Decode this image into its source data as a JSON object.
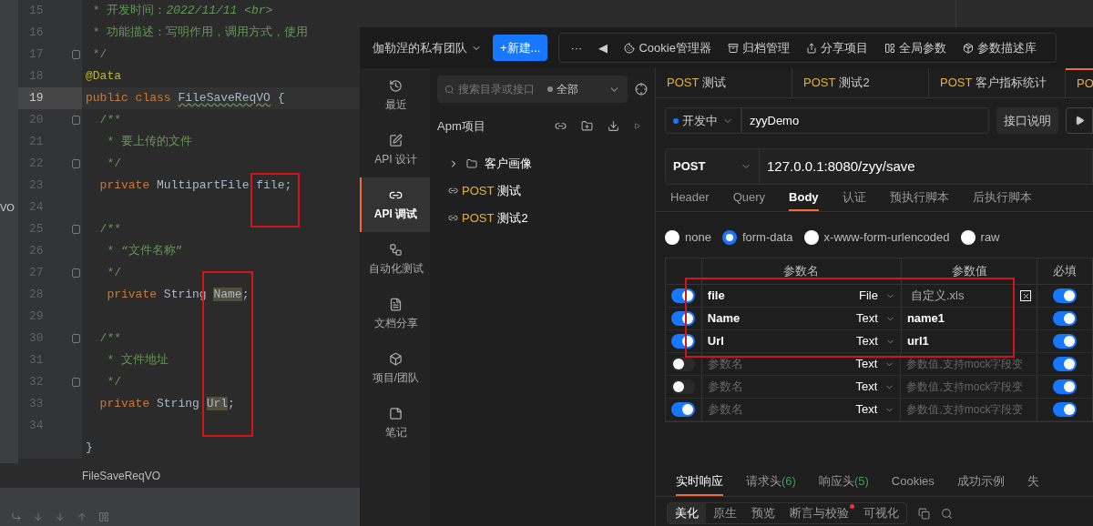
{
  "editor": {
    "lines": [
      {
        "number": "15",
        "fold": false,
        "current": false,
        "segments": [
          {
            "text": " * 开发时间：",
            "kind": "doc"
          },
          {
            "text": "2022/11/11 <br>",
            "kind": "doc_tag"
          }
        ]
      },
      {
        "number": "16",
        "fold": false,
        "current": false,
        "segments": [
          {
            "text": " * 功能描述：写明作用，调用方式，使用",
            "kind": "doc"
          }
        ]
      },
      {
        "number": "17",
        "fold": true,
        "current": false,
        "segments": [
          {
            "text": " */",
            "kind": "doc"
          }
        ]
      },
      {
        "number": "18",
        "fold": false,
        "current": false,
        "segments": [
          {
            "text": "@Data",
            "kind": "annotation"
          }
        ]
      },
      {
        "number": "19",
        "fold": false,
        "current": true,
        "segments": [
          {
            "text": "public class ",
            "kind": "keyword"
          },
          {
            "text": "FileSaveReqVO",
            "kind": "class_name"
          },
          {
            "text": " {",
            "kind": "plain"
          }
        ]
      },
      {
        "number": "20",
        "fold": true,
        "current": false,
        "segments": [
          {
            "text": "  /**",
            "kind": "doc"
          }
        ]
      },
      {
        "number": "21",
        "fold": false,
        "current": false,
        "segments": [
          {
            "text": "   * 要上传的文件",
            "kind": "doc"
          }
        ]
      },
      {
        "number": "22",
        "fold": true,
        "current": false,
        "segments": [
          {
            "text": "   */",
            "kind": "doc"
          }
        ]
      },
      {
        "number": "23",
        "fold": false,
        "current": false,
        "segments": [
          {
            "text": "  private ",
            "kind": "keyword"
          },
          {
            "text": "MultipartFile file;",
            "kind": "plain"
          }
        ]
      },
      {
        "number": "24",
        "fold": false,
        "current": false,
        "edge_text": "VO"
      },
      {
        "number": "25",
        "fold": true,
        "current": false,
        "segments": [
          {
            "text": "  /**",
            "kind": "doc"
          }
        ]
      },
      {
        "number": "26",
        "fold": false,
        "current": false,
        "segments": [
          {
            "text": "   * “文件名称”",
            "kind": "doc"
          }
        ]
      },
      {
        "number": "27",
        "fold": true,
        "current": false,
        "segments": [
          {
            "text": "   */",
            "kind": "doc"
          }
        ]
      },
      {
        "number": "28",
        "fold": false,
        "current": false,
        "segments": [
          {
            "text": "   private ",
            "kind": "keyword"
          },
          {
            "text": "String ",
            "kind": "plain"
          },
          {
            "text": "Name",
            "kind": "highlight"
          },
          {
            "text": ";",
            "kind": "plain"
          }
        ]
      },
      {
        "number": "29",
        "fold": false,
        "current": false
      },
      {
        "number": "30",
        "fold": true,
        "current": false,
        "segments": [
          {
            "text": "  /**",
            "kind": "doc"
          }
        ]
      },
      {
        "number": "31",
        "fold": false,
        "current": false,
        "segments": [
          {
            "text": "   * 文件地址",
            "kind": "doc"
          }
        ]
      },
      {
        "number": "32",
        "fold": true,
        "current": false,
        "segments": [
          {
            "text": "   */",
            "kind": "doc"
          }
        ]
      },
      {
        "number": "33",
        "fold": false,
        "current": false,
        "segments": [
          {
            "text": "  private ",
            "kind": "keyword"
          },
          {
            "text": "String ",
            "kind": "plain"
          },
          {
            "text": "Url",
            "kind": "highlight"
          },
          {
            "text": ";",
            "kind": "plain"
          }
        ]
      },
      {
        "number": "34",
        "fold": false,
        "current": false
      },
      {
        "fold": false,
        "current": false,
        "segments": [
          {
            "text": "}",
            "kind": "plain"
          }
        ]
      }
    ],
    "breadcrumb": "FileSaveReqVO"
  },
  "topbar": {
    "team": "伽勒涅的私有团队",
    "new_button": "+新建...",
    "more": "···",
    "collapse": "◀",
    "tools": [
      "Cookie管理器",
      "归档管理",
      "分享项目",
      "全局参数",
      "参数描述库"
    ]
  },
  "sidebar": {
    "items": [
      {
        "label": "最近",
        "selected": false
      },
      {
        "label": "API 设计",
        "selected": false
      },
      {
        "label": "API 调试",
        "selected": true
      },
      {
        "label": "自动化测试",
        "selected": false
      },
      {
        "label": "文档分享",
        "selected": false
      },
      {
        "label": "项目/团队",
        "selected": false
      },
      {
        "label": "笔记",
        "selected": false
      }
    ]
  },
  "tree": {
    "search": {
      "placeholder": "搜索目录或接口"
    },
    "filter": "全部",
    "project": "Apm项目",
    "items": [
      {
        "kind": "folder",
        "label": "客户画像",
        "expanded": false
      },
      {
        "kind": "api",
        "method": "POST",
        "label": "测试"
      },
      {
        "kind": "api",
        "method": "POST",
        "label": "测试2"
      }
    ]
  },
  "tabs": [
    {
      "method": "POST",
      "label": "测试",
      "selected": false
    },
    {
      "method": "POST",
      "label": "测试2",
      "selected": false
    },
    {
      "method": "POST",
      "label": "客户指标统计",
      "selected": false
    },
    {
      "method": "PO",
      "selected": true
    }
  ],
  "request": {
    "environment": "开发中",
    "name": "zyyDemo",
    "doc_button": "接口说明",
    "method": "POST",
    "url": "127.0.0.1:8080/zyy/save",
    "subtabs": [
      {
        "label": "Header",
        "selected": false
      },
      {
        "label": "Query",
        "selected": false
      },
      {
        "label": "Body",
        "selected": true
      },
      {
        "label": "认证",
        "selected": false
      },
      {
        "label": "预执行脚本",
        "selected": false
      },
      {
        "label": "后执行脚本",
        "selected": false
      }
    ],
    "body_types": [
      {
        "label": "none",
        "selected": false
      },
      {
        "label": "form-data",
        "selected": true
      },
      {
        "label": "x-www-form-urlencoded",
        "selected": false
      },
      {
        "label": "raw",
        "selected": false
      }
    ]
  },
  "params": {
    "columns": [
      "参数名",
      "参数值",
      "必填"
    ],
    "rows": [
      {
        "enabled": true,
        "name": "file",
        "type": "File",
        "value": "自定义.xls",
        "clearable": true,
        "required": true
      },
      {
        "enabled": true,
        "name": "Name",
        "type": "Text",
        "value": "name1",
        "clearable": false,
        "required": true
      },
      {
        "enabled": true,
        "name": "Url",
        "type": "Text",
        "value": "url1",
        "clearable": false,
        "required": true
      },
      {
        "enabled": false,
        "name_placeholder": "参数名",
        "type": "Text",
        "value_placeholder": "参数值,支持mock字段变",
        "clearable": false,
        "required": true
      },
      {
        "enabled": false,
        "name_placeholder": "参数名",
        "type": "Text",
        "value_placeholder": "参数值,支持mock字段变",
        "clearable": false,
        "required": true
      },
      {
        "enabled": true,
        "name_placeholder": "参数名",
        "type": "Text",
        "value_placeholder": "参数值,支持mock字段变",
        "clearable": false,
        "required": true
      }
    ]
  },
  "response": {
    "tabs": [
      {
        "label": "实时响应",
        "selected": true
      },
      {
        "label": "请求头",
        "count": "(6)",
        "selected": false
      },
      {
        "label": "响应头",
        "count": "(5)",
        "selected": false
      },
      {
        "label": "Cookies",
        "selected": false
      },
      {
        "label": "成功示例",
        "selected": false
      },
      {
        "label": "失",
        "selected": false
      }
    ],
    "views": [
      {
        "label": "美化",
        "selected": true,
        "badge": false
      },
      {
        "label": "原生",
        "selected": false,
        "badge": false
      },
      {
        "label": "预览",
        "selected": false,
        "badge": false
      },
      {
        "label": "断言与校验",
        "selected": false,
        "badge": true
      },
      {
        "label": "可视化",
        "selected": false,
        "badge": false
      }
    ]
  }
}
